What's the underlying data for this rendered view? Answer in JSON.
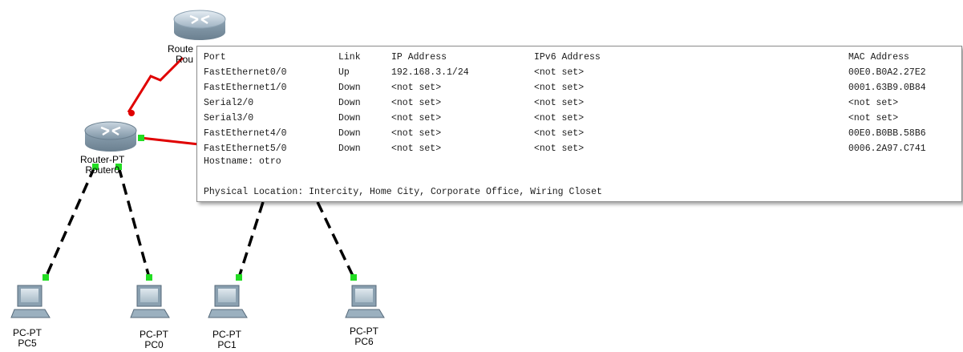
{
  "devices": [
    {
      "id": "router-top",
      "type": "Route",
      "name": "Rou"
    },
    {
      "id": "router0",
      "type": "Router-PT",
      "name": "Router0"
    },
    {
      "id": "pc5",
      "type": "PC-PT",
      "name": "PC5"
    },
    {
      "id": "pc0",
      "type": "PC-PT",
      "name": "PC0"
    },
    {
      "id": "pc1",
      "type": "PC-PT",
      "name": "PC1"
    },
    {
      "id": "pc6",
      "type": "PC-PT",
      "name": "PC6"
    }
  ],
  "tooltip": {
    "headers": {
      "port": "Port",
      "link": "Link",
      "ip": "IP Address",
      "ipv6": "IPv6 Address",
      "mac": "MAC Address"
    },
    "rows": [
      {
        "port": "FastEthernet0/0",
        "link": "Up",
        "ip": "192.168.3.1/24",
        "ipv6": "<not set>",
        "mac": "00E0.B0A2.27E2"
      },
      {
        "port": "FastEthernet1/0",
        "link": "Down",
        "ip": "<not set>",
        "ipv6": "<not set>",
        "mac": "0001.63B9.0B84"
      },
      {
        "port": "Serial2/0",
        "link": "Down",
        "ip": "<not set>",
        "ipv6": "<not set>",
        "mac": "<not set>"
      },
      {
        "port": "Serial3/0",
        "link": "Down",
        "ip": "<not set>",
        "ipv6": "<not set>",
        "mac": "<not set>"
      },
      {
        "port": "FastEthernet4/0",
        "link": "Down",
        "ip": "<not set>",
        "ipv6": "<not set>",
        "mac": "00E0.B0BB.58B6"
      },
      {
        "port": "FastEthernet5/0",
        "link": "Down",
        "ip": "<not set>",
        "ipv6": "<not set>",
        "mac": "0006.2A97.C741"
      }
    ],
    "hostname": "Hostname: otro",
    "location": "Physical Location: Intercity, Home City, Corporate Office, Wiring Closet"
  },
  "colors": {
    "serial_link": "#e00000",
    "ethernet_link": "#000000",
    "link_up": "#22dd22",
    "link_down": "#e00000",
    "router_body": "#9fb6c6",
    "pc_body": "#b8c6d0"
  }
}
